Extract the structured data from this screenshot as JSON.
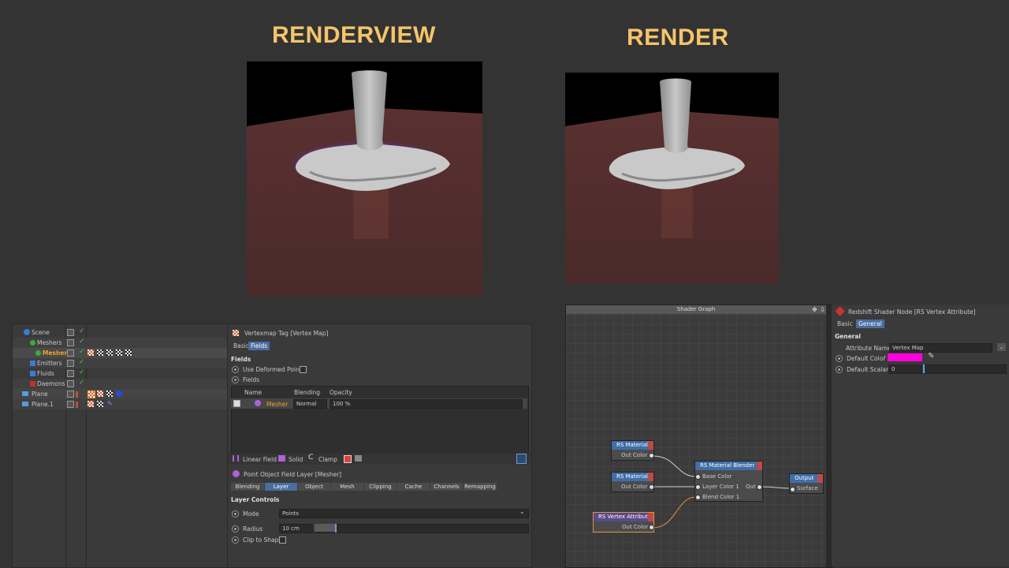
{
  "headings": {
    "renderview": "RENDERVIEW",
    "render": "RENDER"
  },
  "object_manager": {
    "items": [
      {
        "name": "Scene",
        "color": "#f0a030"
      },
      {
        "name": "Meshers",
        "color": "#f0a030"
      },
      {
        "name": "Mesher",
        "color": "#f0a030"
      },
      {
        "name": "Emitters",
        "color": "#d0d0d0"
      },
      {
        "name": "Fluids",
        "color": "#d0d0d0"
      },
      {
        "name": "Daemons",
        "color": "#d0d0d0"
      },
      {
        "name": "Plane",
        "color": "#d0d0d0"
      },
      {
        "name": "Plane.1",
        "color": "#d0d0d0"
      }
    ]
  },
  "attributes": {
    "tag_title": "Vertexmap Tag [Vertex Map]",
    "tabs": [
      "Basic",
      "Fields"
    ],
    "active_tab": "Fields",
    "section_fields": "Fields",
    "use_deformed_points": "Use Deformed Points",
    "fields_label": "Fields",
    "columns": [
      "Name",
      "Blending",
      "Opacity"
    ],
    "row": {
      "name": "Mesher",
      "blending": "Normal",
      "opacity": "100 %"
    },
    "toolbar": [
      "Linear Field",
      "Solid",
      "Clamp"
    ],
    "layer_title": "Point Object Field Layer [Mesher]",
    "layer_tabs": [
      "Blending",
      "Layer",
      "Object",
      "Mesh",
      "Clipping",
      "Cache",
      "Channels",
      "Remapping"
    ],
    "active_layer_tab": "Layer",
    "layer_controls": "Layer Controls",
    "mode_label": "Mode",
    "mode_value": "Points",
    "radius_label": "Radius",
    "radius_value": "10 cm",
    "clip_label": "Clip to Shape"
  },
  "shader_graph": {
    "title": "Shader Graph",
    "nodes": {
      "material1": {
        "title": "RS Material",
        "out": "Out Color"
      },
      "material2": {
        "title": "RS Material",
        "out": "Out Color"
      },
      "vertex": {
        "title": "RS Vertex Attribute",
        "out": "Out Color"
      },
      "blender": {
        "title": "RS Material Blender",
        "in1": "Base Color",
        "in2": "Layer Color 1",
        "in3": "Blend Color 1",
        "out": "Out"
      },
      "output": {
        "title": "Output",
        "in1": "Surface"
      }
    }
  },
  "node_attributes": {
    "title": "Redshift Shader Node [RS Vertex Attribute]",
    "tabs": [
      "Basic",
      "General"
    ],
    "active_tab": "General",
    "section": "General",
    "attribute_name_label": "Attribute Name",
    "attribute_name_value": "Vertex Map",
    "default_color_label": "Default Color",
    "default_color": "#ff00dd",
    "default_scalar_label": "Default Scalar",
    "default_scalar_value": "0"
  },
  "colors": {
    "heading": "#f5c46b",
    "accent_tab": "#4a6da0",
    "mesher_orange": "#f0a030"
  }
}
